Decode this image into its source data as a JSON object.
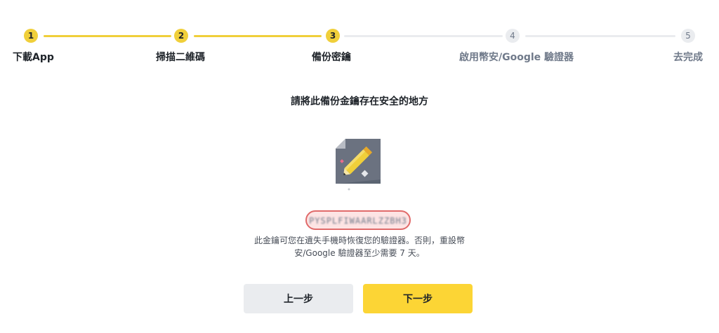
{
  "stepper": {
    "steps": [
      {
        "number": "1",
        "label": "下載App"
      },
      {
        "number": "2",
        "label": "掃描二維碼"
      },
      {
        "number": "3",
        "label": "備份密鑰"
      },
      {
        "number": "4",
        "label": "啟用幣安/Google 驗證器"
      },
      {
        "number": "5",
        "label": "去完成"
      }
    ],
    "current_step": 3,
    "active_color": "#F0CF3A",
    "inactive_color": "#EAECEF"
  },
  "main": {
    "title": "請將此備份金鑰存在安全的地方",
    "illustration_icon": "note-pencil-icon",
    "backup_key": "PYSPLFIWAARLZZBH3",
    "description": "此金鑰可您在遺失手機時恢復您的驗證器。否則，重設幣安/Google 驗證器至少需要 7 天。"
  },
  "buttons": {
    "prev_label": "上一步",
    "next_label": "下一步"
  },
  "colors": {
    "brand_yellow": "#FCD535",
    "highlight_border": "#E06A6A",
    "highlight_fill": "#FDE4E4"
  }
}
